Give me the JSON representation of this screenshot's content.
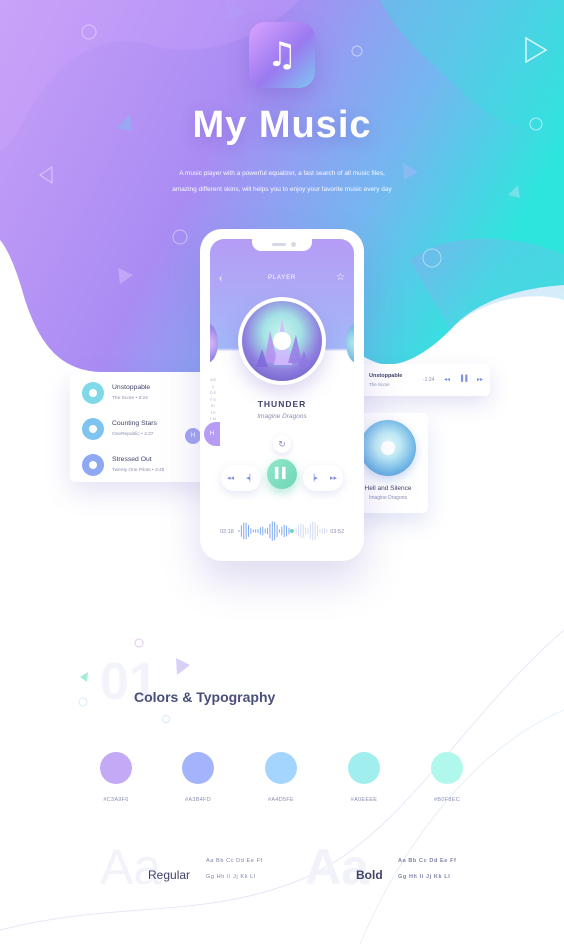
{
  "hero": {
    "title": "My Music",
    "description": "A music player with a powerful equalizer, a fast search of all music files, amazing different skins, will helps you to enjoy your favorite music every day",
    "colors": {
      "gradient_start": "#C49BF7",
      "gradient_end": "#2EE5DD"
    }
  },
  "app_icon": {
    "icon": "music-note-icon",
    "glyph": "♫"
  },
  "player": {
    "header": "PLAYER",
    "song_title": "THUNDER",
    "artist": "Imagine Dragons",
    "time_elapsed": "02:18",
    "time_total": "03:52",
    "progress": 0.6,
    "icons": {
      "back": "chevron-left-icon",
      "favorite": "star-icon",
      "repeat": "repeat-icon",
      "prev": "skip-back-icon",
      "rewind": "rewind-icon",
      "pause": "pause-icon",
      "forward": "fast-forward-icon",
      "next": "skip-forward-icon"
    },
    "glyphs": {
      "back": "‹",
      "star": "☆",
      "repeat": "↻",
      "prev": "◂◂",
      "rewind": "◂▏",
      "pause": "▌▌",
      "forward": "▕▸",
      "next": "▸▸"
    }
  },
  "song_list": [
    {
      "title": "Unstoppable",
      "meta": "The Score  •  3:24",
      "color": "#7FD9E8"
    },
    {
      "title": "Counting Stars",
      "meta": "OneRepublic  •  4:37",
      "color": "#7FC4F0"
    },
    {
      "title": "Stressed Out",
      "meta": "Twenty One Pilots  •  3:45",
      "color": "#8FA8F2"
    }
  ],
  "alpha_index": "A B C D E F G H I J K L M N O P Q R",
  "index_letter": "H",
  "mini_player": {
    "title": "Unstoppable",
    "artist": "The Score",
    "time": "-1:24",
    "glyphs": {
      "prev": "◂◂",
      "pause": "▌▌",
      "next": "▸▸"
    }
  },
  "album_card": {
    "title": "Hell and Silence",
    "artist": "Imagine Dragons"
  },
  "section": {
    "number": "01",
    "title": "Colors & Typography"
  },
  "palette": [
    {
      "hex": "#C3A9F6",
      "label": "#C3A9F6"
    },
    {
      "hex": "#A3B4FD",
      "label": "#A3B4FD"
    },
    {
      "hex": "#A4D5FE",
      "label": "#A4D5FE"
    },
    {
      "hex": "#A0EEEE",
      "label": "#A0EEEE"
    },
    {
      "hex": "#B0F8EC",
      "label": "#B0F8EC"
    }
  ],
  "typography": {
    "sample_bg": "Aa",
    "regular_label": "Regular",
    "bold_label": "Bold",
    "glyph_line1": "Aa  Bb  Cc  Dd  Ee  Ff",
    "glyph_line2": "Gg  Hh  Ii  Jj  Kk  Ll"
  }
}
